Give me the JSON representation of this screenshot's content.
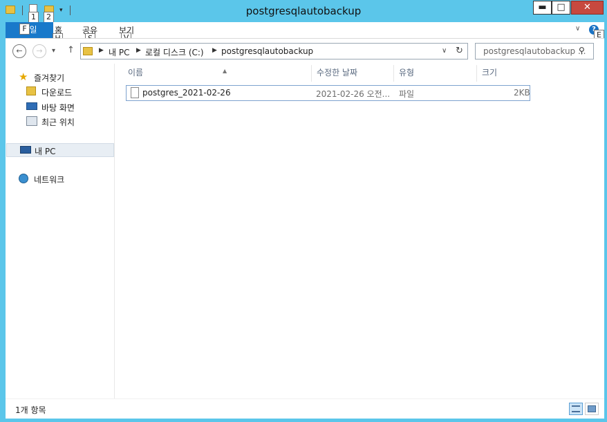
{
  "window": {
    "title": "postgresqlautobackup"
  },
  "quick_access": {
    "keytips": [
      "1",
      "2"
    ]
  },
  "window_controls": {
    "minimize": "▬",
    "maximize": "□",
    "close": "✕"
  },
  "ribbon": {
    "tabs": [
      {
        "label": "파일",
        "keytip": "F"
      },
      {
        "label": "홈",
        "keytip": "H"
      },
      {
        "label": "공유",
        "keytip": "S"
      },
      {
        "label": "보기",
        "keytip": "V"
      }
    ],
    "help_keytip": "E",
    "help_label": "?"
  },
  "nav": {
    "breadcrumbs": [
      "내 PC",
      "로컬 디스크 (C:)",
      "postgresqlautobackup"
    ],
    "search_placeholder": "postgresqlautobackup ..."
  },
  "sidebar": {
    "favorites": {
      "label": "즐겨찾기",
      "icon": "star-icon"
    },
    "favorite_items": [
      {
        "label": "다운로드",
        "icon": "download-folder-icon"
      },
      {
        "label": "바탕 화면",
        "icon": "desktop-icon"
      },
      {
        "label": "최근 위치",
        "icon": "recent-places-icon"
      }
    ],
    "this_pc": {
      "label": "내 PC",
      "icon": "computer-icon"
    },
    "network": {
      "label": "네트워크",
      "icon": "network-icon"
    }
  },
  "columns": {
    "name": "이름",
    "modified": "수정한 날짜",
    "type": "유형",
    "size": "크기"
  },
  "files": [
    {
      "name": "postgres_2021-02-26",
      "modified": "2021-02-26 오전...",
      "type": "파일",
      "size": "2KB"
    }
  ],
  "status": {
    "count_text": "1개 항목"
  },
  "colors": {
    "accent": "#5bc6ea",
    "file_tab": "#1979ca",
    "close_button": "#c7493f"
  }
}
